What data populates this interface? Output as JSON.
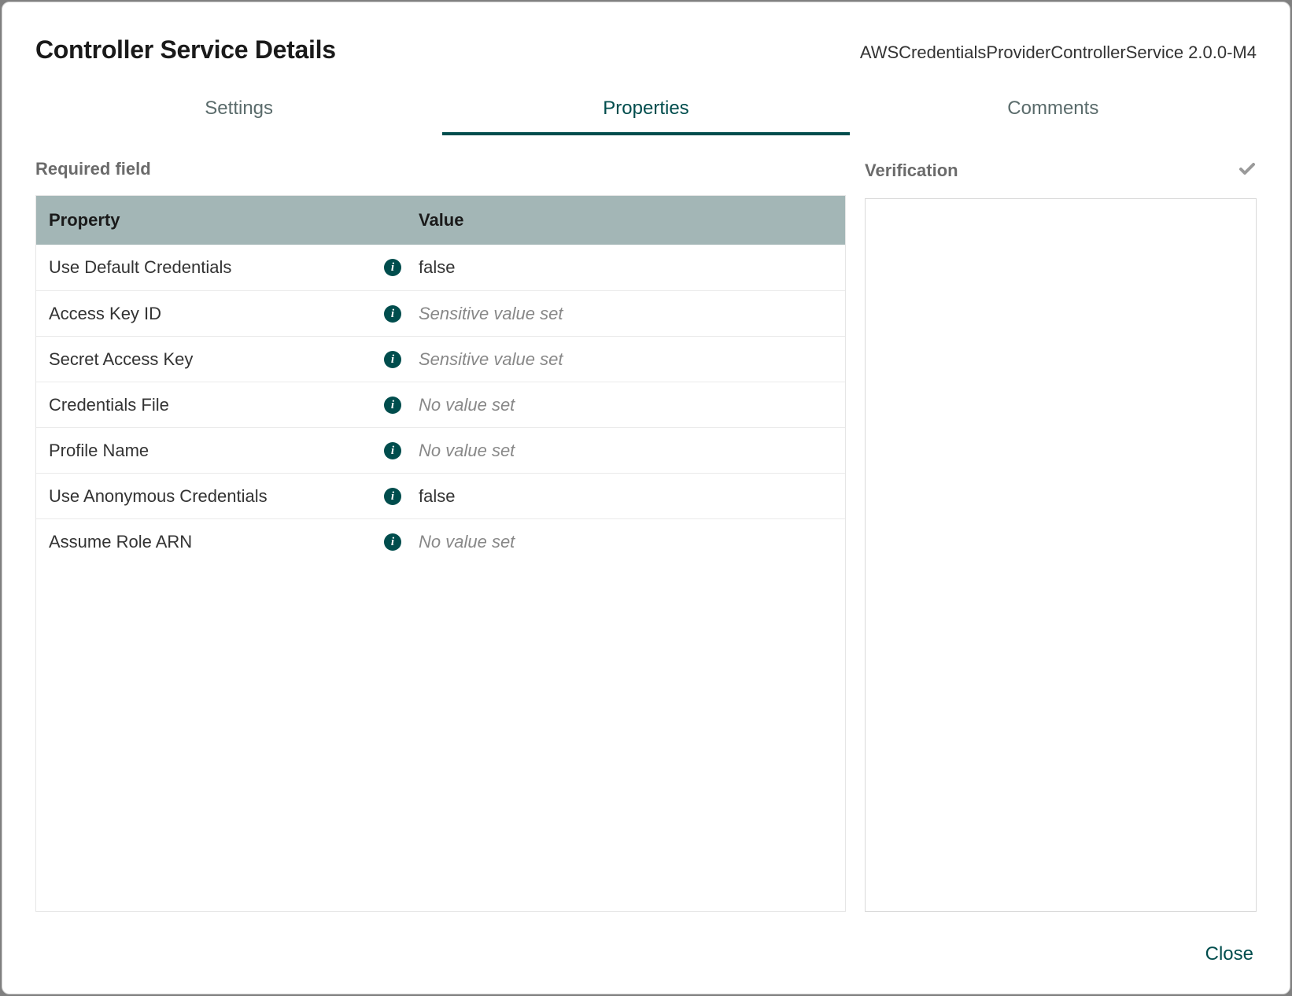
{
  "header": {
    "title": "Controller Service Details",
    "subtitle": "AWSCredentialsProviderControllerService 2.0.0-M4"
  },
  "tabs": {
    "settings": "Settings",
    "properties": "Properties",
    "comments": "Comments"
  },
  "required_label": "Required field",
  "table": {
    "headers": {
      "property": "Property",
      "value": "Value"
    },
    "rows": [
      {
        "name": "Use Default Credentials",
        "value": "false",
        "placeholder": false
      },
      {
        "name": "Access Key ID",
        "value": "Sensitive value set",
        "placeholder": true
      },
      {
        "name": "Secret Access Key",
        "value": "Sensitive value set",
        "placeholder": true
      },
      {
        "name": "Credentials File",
        "value": "No value set",
        "placeholder": true
      },
      {
        "name": "Profile Name",
        "value": "No value set",
        "placeholder": true
      },
      {
        "name": "Use Anonymous Credentials",
        "value": "false",
        "placeholder": false
      },
      {
        "name": "Assume Role ARN",
        "value": "No value set",
        "placeholder": true
      }
    ]
  },
  "verification": {
    "title": "Verification"
  },
  "footer": {
    "close": "Close"
  }
}
